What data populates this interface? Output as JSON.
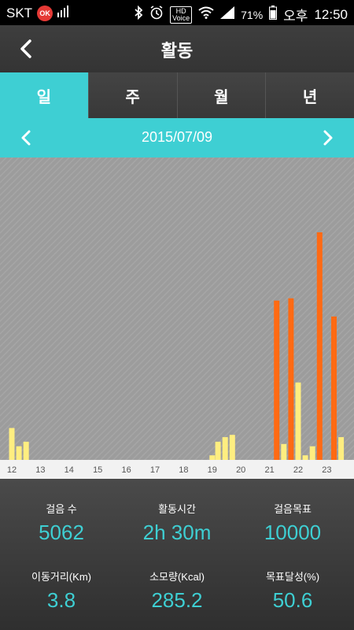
{
  "status_bar": {
    "carrier": "SKT",
    "ok_badge": "OK",
    "hd_label": "HD",
    "voice_label": "Voice",
    "battery_percent": "71%",
    "ampm": "오후",
    "time": "12:50"
  },
  "header": {
    "title": "활동"
  },
  "tabs": [
    {
      "label": "일",
      "active": true
    },
    {
      "label": "주",
      "active": false
    },
    {
      "label": "월",
      "active": false
    },
    {
      "label": "년",
      "active": false
    }
  ],
  "date_nav": {
    "date": "2015/07/09"
  },
  "colors": {
    "accent": "#3ecfd3",
    "bar_low": "#ffee80",
    "bar_high": "#ff6a13",
    "chart_bg": "#9e9e9e"
  },
  "chart_data": {
    "type": "bar",
    "x_tick_labels": [
      "12",
      "13",
      "14",
      "15",
      "16",
      "17",
      "18",
      "19",
      "20",
      "21",
      "22",
      "23"
    ],
    "x_range": [
      12,
      24
    ],
    "ylim": [
      0,
      100
    ],
    "bars": [
      {
        "hour": 12.0,
        "value": 14,
        "level": "low"
      },
      {
        "hour": 12.25,
        "value": 6,
        "level": "low"
      },
      {
        "hour": 12.5,
        "value": 8,
        "level": "low"
      },
      {
        "hour": 19.0,
        "value": 2,
        "level": "low"
      },
      {
        "hour": 19.2,
        "value": 8,
        "level": "low"
      },
      {
        "hour": 19.45,
        "value": 10,
        "level": "low"
      },
      {
        "hour": 19.7,
        "value": 11,
        "level": "low"
      },
      {
        "hour": 21.25,
        "value": 70,
        "level": "high"
      },
      {
        "hour": 21.5,
        "value": 7,
        "level": "low"
      },
      {
        "hour": 21.75,
        "value": 71,
        "level": "high"
      },
      {
        "hour": 22.0,
        "value": 34,
        "level": "low"
      },
      {
        "hour": 22.25,
        "value": 2,
        "level": "low"
      },
      {
        "hour": 22.5,
        "value": 6,
        "level": "low"
      },
      {
        "hour": 22.75,
        "value": 100,
        "level": "high"
      },
      {
        "hour": 23.25,
        "value": 63,
        "level": "high"
      },
      {
        "hour": 23.5,
        "value": 10,
        "level": "low"
      }
    ],
    "grid": false
  },
  "stats": [
    {
      "label": "걸음 수",
      "value": "5062"
    },
    {
      "label": "활동시간",
      "value": "2h 30m"
    },
    {
      "label": "걸음목표",
      "value": "10000"
    },
    {
      "label": "이동거리(Km)",
      "value": "3.8"
    },
    {
      "label": "소모량(Kcal)",
      "value": "285.2"
    },
    {
      "label": "목표달성(%)",
      "value": "50.6"
    }
  ]
}
